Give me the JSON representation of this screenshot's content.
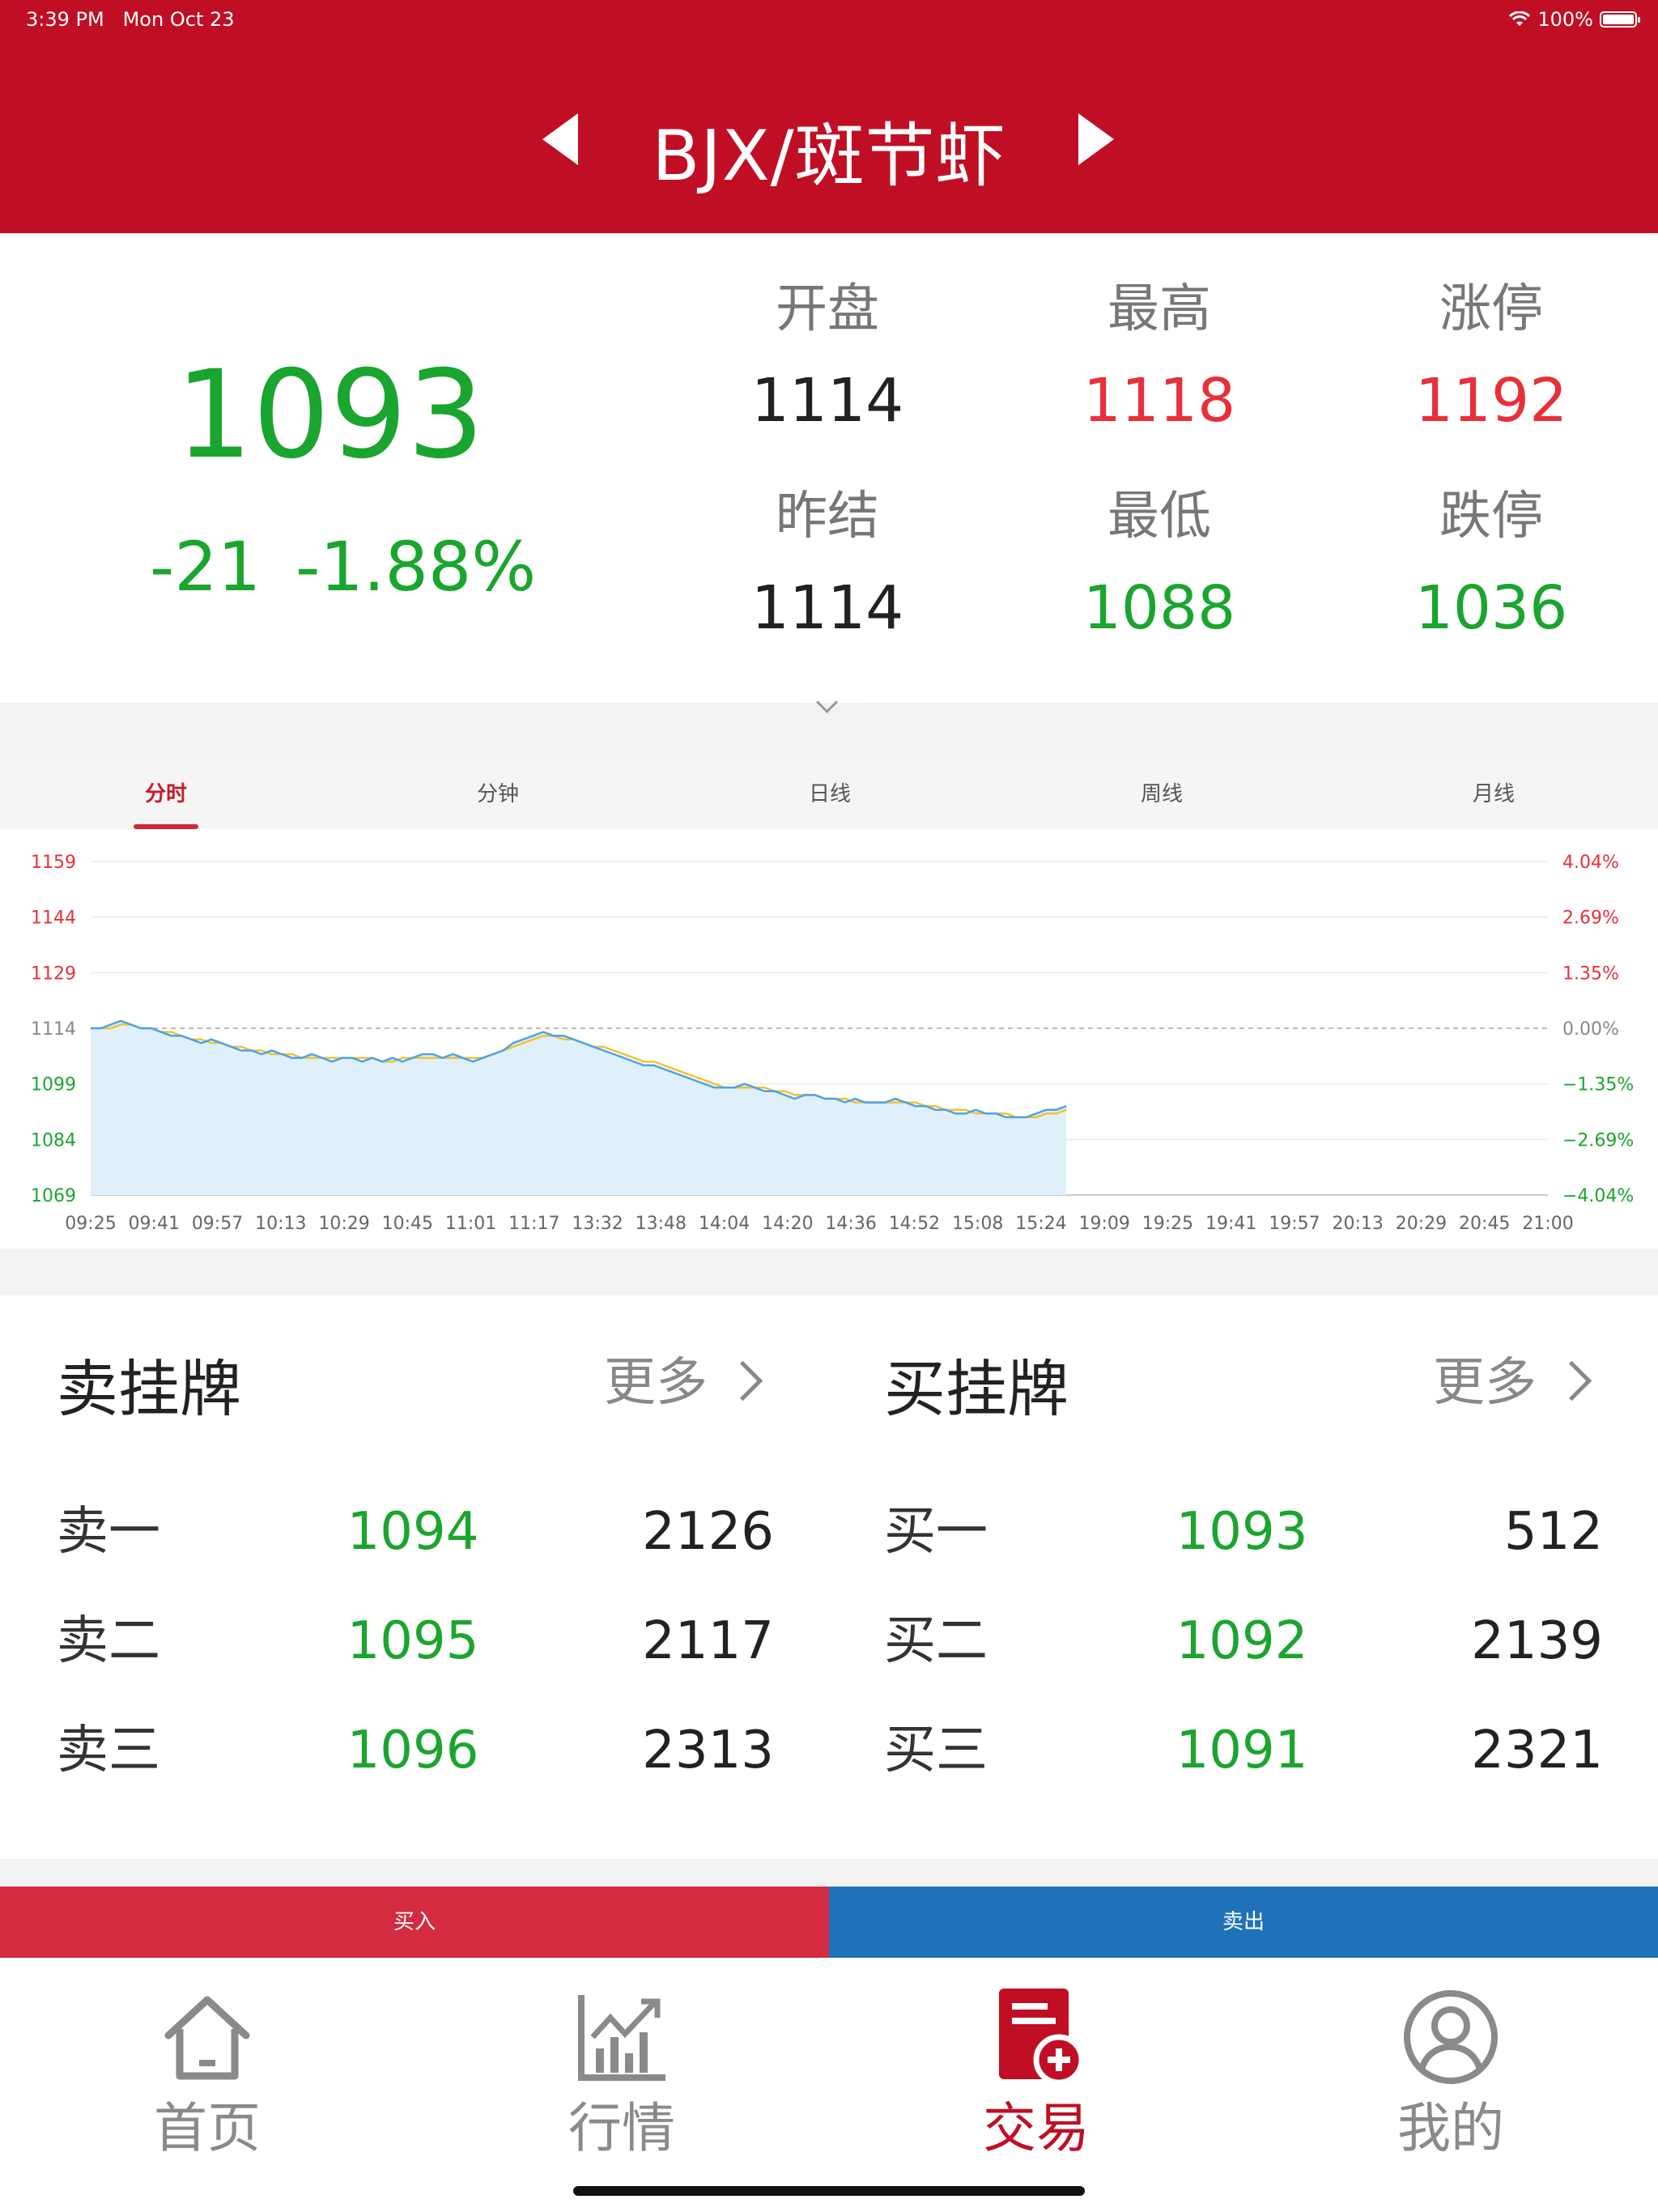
{
  "status": {
    "time": "3:39 PM",
    "date": "Mon Oct 23",
    "battery": "100%"
  },
  "header": {
    "title": "BJX/斑节虾",
    "prev_icon": "caret-left-icon",
    "next_icon": "caret-right-icon"
  },
  "quote": {
    "price": "1093",
    "change": "-21",
    "change_pct": "-1.88%",
    "stats": [
      {
        "label": "开盘",
        "value": "1114",
        "color": "#222222"
      },
      {
        "label": "最高",
        "value": "1118",
        "color": "#e8303a"
      },
      {
        "label": "涨停",
        "value": "1192",
        "color": "#e8303a"
      },
      {
        "label": "昨结",
        "value": "1114",
        "color": "#222222"
      },
      {
        "label": "最低",
        "value": "1088",
        "color": "#1aa52e"
      },
      {
        "label": "跌停",
        "value": "1036",
        "color": "#1aa52e"
      }
    ]
  },
  "tabs": [
    {
      "label": "分时",
      "active": true
    },
    {
      "label": "分钟",
      "active": false
    },
    {
      "label": "日线",
      "active": false
    },
    {
      "label": "周线",
      "active": false
    },
    {
      "label": "月线",
      "active": false
    }
  ],
  "chart_data": {
    "type": "line",
    "base_price": 1114,
    "ylim": [
      1069,
      1159
    ],
    "y_ticks_left": [
      "1159",
      "1144",
      "1129",
      "1114",
      "1099",
      "1084",
      "1069"
    ],
    "y_ticks_right": [
      "4.04%",
      "2.69%",
      "1.35%",
      "0.00%",
      "−1.35%",
      "−2.69%",
      "−4.04%"
    ],
    "x_ticks": [
      "09:25",
      "09:41",
      "09:57",
      "10:13",
      "10:29",
      "10:45",
      "11:01",
      "11:17",
      "13:32",
      "13:48",
      "14:04",
      "14:20",
      "14:36",
      "14:52",
      "15:08",
      "15:24",
      "19:09",
      "19:25",
      "19:41",
      "19:57",
      "20:13",
      "20:29",
      "20:45",
      "21:00"
    ],
    "series": [
      {
        "values": [
          1114,
          1114,
          1115,
          1116,
          1115,
          1114,
          1114,
          1113,
          1112,
          1112,
          1111,
          1110,
          1111,
          1110,
          1109,
          1108,
          1108,
          1107,
          1108,
          1107,
          1106,
          1106,
          1107,
          1106,
          1105,
          1106,
          1106,
          1105,
          1106,
          1105,
          1106,
          1105,
          1106,
          1107,
          1107,
          1106,
          1107,
          1106,
          1105,
          1106,
          1107,
          1108,
          1110,
          1111,
          1112,
          1113,
          1112,
          1112,
          1111,
          1110,
          1109,
          1108,
          1107,
          1106,
          1105,
          1104,
          1104,
          1103,
          1102,
          1101,
          1100,
          1099,
          1098,
          1098,
          1098,
          1099,
          1098,
          1097,
          1097,
          1096,
          1095,
          1096,
          1096,
          1095,
          1095,
          1094,
          1095,
          1094,
          1094,
          1094,
          1095,
          1094,
          1093,
          1093,
          1092,
          1092,
          1091,
          1091,
          1092,
          1091,
          1091,
          1090,
          1090,
          1090,
          1091,
          1092,
          1092,
          1093
        ]
      },
      {
        "values": [
          1114,
          1114,
          1114,
          1115,
          1115,
          1114,
          1114,
          1113,
          1113,
          1112,
          1111,
          1111,
          1110,
          1110,
          1109,
          1109,
          1108,
          1108,
          1107,
          1107,
          1107,
          1106,
          1106,
          1106,
          1106,
          1106,
          1106,
          1106,
          1106,
          1105,
          1105,
          1106,
          1106,
          1106,
          1106,
          1106,
          1106,
          1106,
          1106,
          1106,
          1107,
          1108,
          1109,
          1110,
          1111,
          1112,
          1112,
          1111,
          1111,
          1110,
          1109,
          1109,
          1108,
          1107,
          1106,
          1105,
          1105,
          1104,
          1103,
          1102,
          1101,
          1100,
          1099,
          1098,
          1098,
          1098,
          1098,
          1098,
          1097,
          1097,
          1096,
          1096,
          1096,
          1095,
          1095,
          1095,
          1094,
          1094,
          1094,
          1094,
          1094,
          1094,
          1094,
          1093,
          1093,
          1092,
          1092,
          1092,
          1091,
          1091,
          1091,
          1091,
          1090,
          1090,
          1090,
          1091,
          1091,
          1092
        ]
      }
    ],
    "colors": {
      "price_line": "#4da3e6",
      "avg_line": "#f2c230",
      "fill": "#dff0fa",
      "up": "#e8303a",
      "down": "#1aa52e"
    }
  },
  "orders": {
    "sell_title": "卖挂牌",
    "buy_title": "买挂牌",
    "more_label": "更多",
    "sell": [
      {
        "name": "卖一",
        "price": "1094",
        "volume": "2126"
      },
      {
        "name": "卖二",
        "price": "1095",
        "volume": "2117"
      },
      {
        "name": "卖三",
        "price": "1096",
        "volume": "2313"
      }
    ],
    "buy": [
      {
        "name": "买一",
        "price": "1093",
        "volume": "512"
      },
      {
        "name": "买二",
        "price": "1092",
        "volume": "2139"
      },
      {
        "name": "买三",
        "price": "1091",
        "volume": "2321"
      }
    ]
  },
  "actions": {
    "buy_label": "买入",
    "sell_label": "卖出",
    "buy_color": "#d42b40",
    "sell_color": "#1f72b8"
  },
  "tabbar": [
    {
      "label": "首页",
      "icon": "home-icon",
      "active": false
    },
    {
      "label": "行情",
      "icon": "market-chart-icon",
      "active": false
    },
    {
      "label": "交易",
      "icon": "trade-document-icon",
      "active": true
    },
    {
      "label": "我的",
      "icon": "profile-icon",
      "active": false
    }
  ],
  "theme": {
    "brand": "#c00f24",
    "inactive_tab": "#8a8a8a"
  }
}
